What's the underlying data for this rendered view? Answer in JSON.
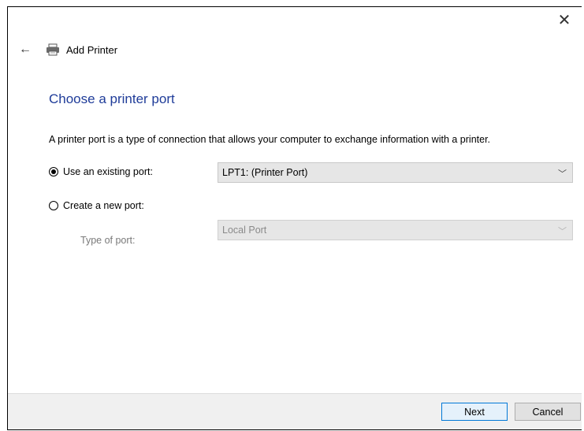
{
  "window": {
    "title": "Add Printer",
    "close_label": "✕",
    "back_label": "←"
  },
  "page": {
    "heading": "Choose a printer port",
    "description": "A printer port is a type of connection that allows your computer to exchange information with a printer."
  },
  "options": {
    "existing_label": "Use an existing port:",
    "existing_selected": true,
    "existing_value": "LPT1: (Printer Port)",
    "new_label": "Create a new port:",
    "new_selected": false,
    "type_label": "Type of port:",
    "type_value": "Local Port",
    "chevron": "﹀"
  },
  "buttons": {
    "next": "Next",
    "cancel": "Cancel"
  },
  "colors": {
    "heading": "#1f3c99",
    "primary_border": "#0078d7"
  }
}
